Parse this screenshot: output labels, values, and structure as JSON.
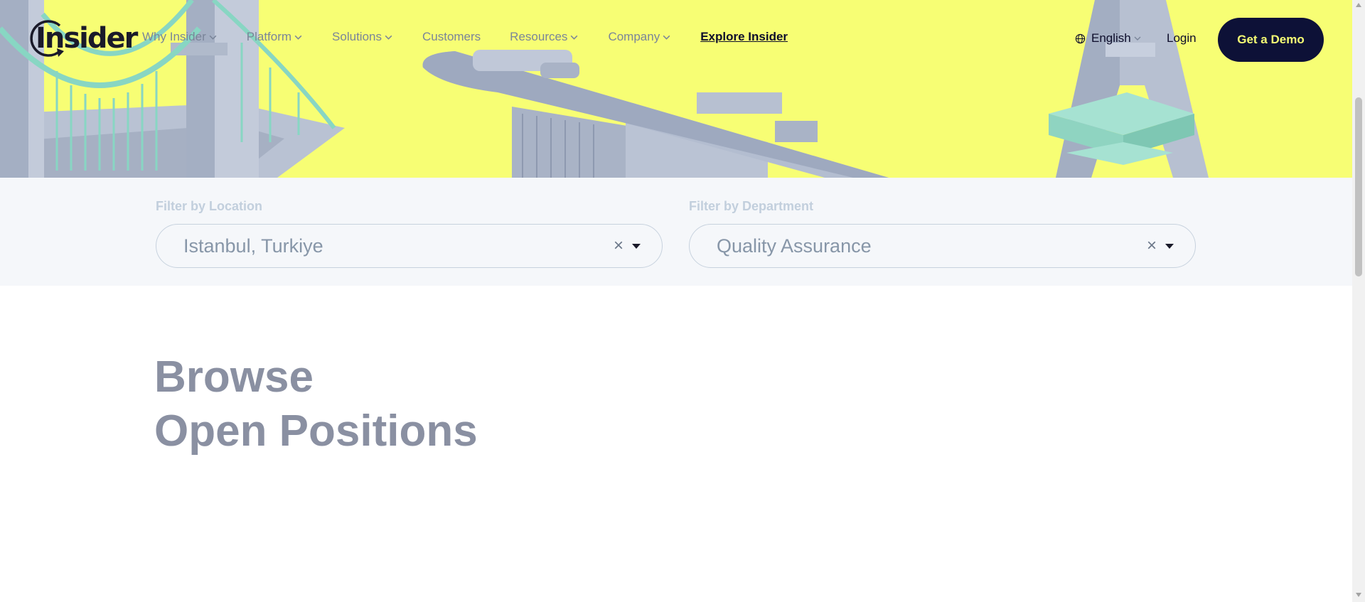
{
  "header": {
    "logo_text": "Insider",
    "nav": [
      {
        "label": "Why Insider",
        "has_dropdown": true
      },
      {
        "label": "Platform",
        "has_dropdown": true
      },
      {
        "label": "Solutions",
        "has_dropdown": true
      },
      {
        "label": "Customers",
        "has_dropdown": false
      },
      {
        "label": "Resources",
        "has_dropdown": true
      },
      {
        "label": "Company",
        "has_dropdown": true
      },
      {
        "label": "Explore Insider",
        "has_dropdown": false
      }
    ],
    "language": "English",
    "login": "Login",
    "cta": "Get a Demo"
  },
  "filters": {
    "location": {
      "label": "Filter by Location",
      "value": "Istanbul, Turkiye",
      "clear": "×"
    },
    "department": {
      "label": "Filter by Department",
      "value": "Quality Assurance",
      "clear": "×"
    }
  },
  "main": {
    "heading_line1": "Browse",
    "heading_line2": "Open Positions"
  },
  "colors": {
    "hero_bg": "#f7fe74",
    "cta_bg": "#0d1137",
    "cta_text": "#f7fe74",
    "heading": "#8a90a2"
  }
}
